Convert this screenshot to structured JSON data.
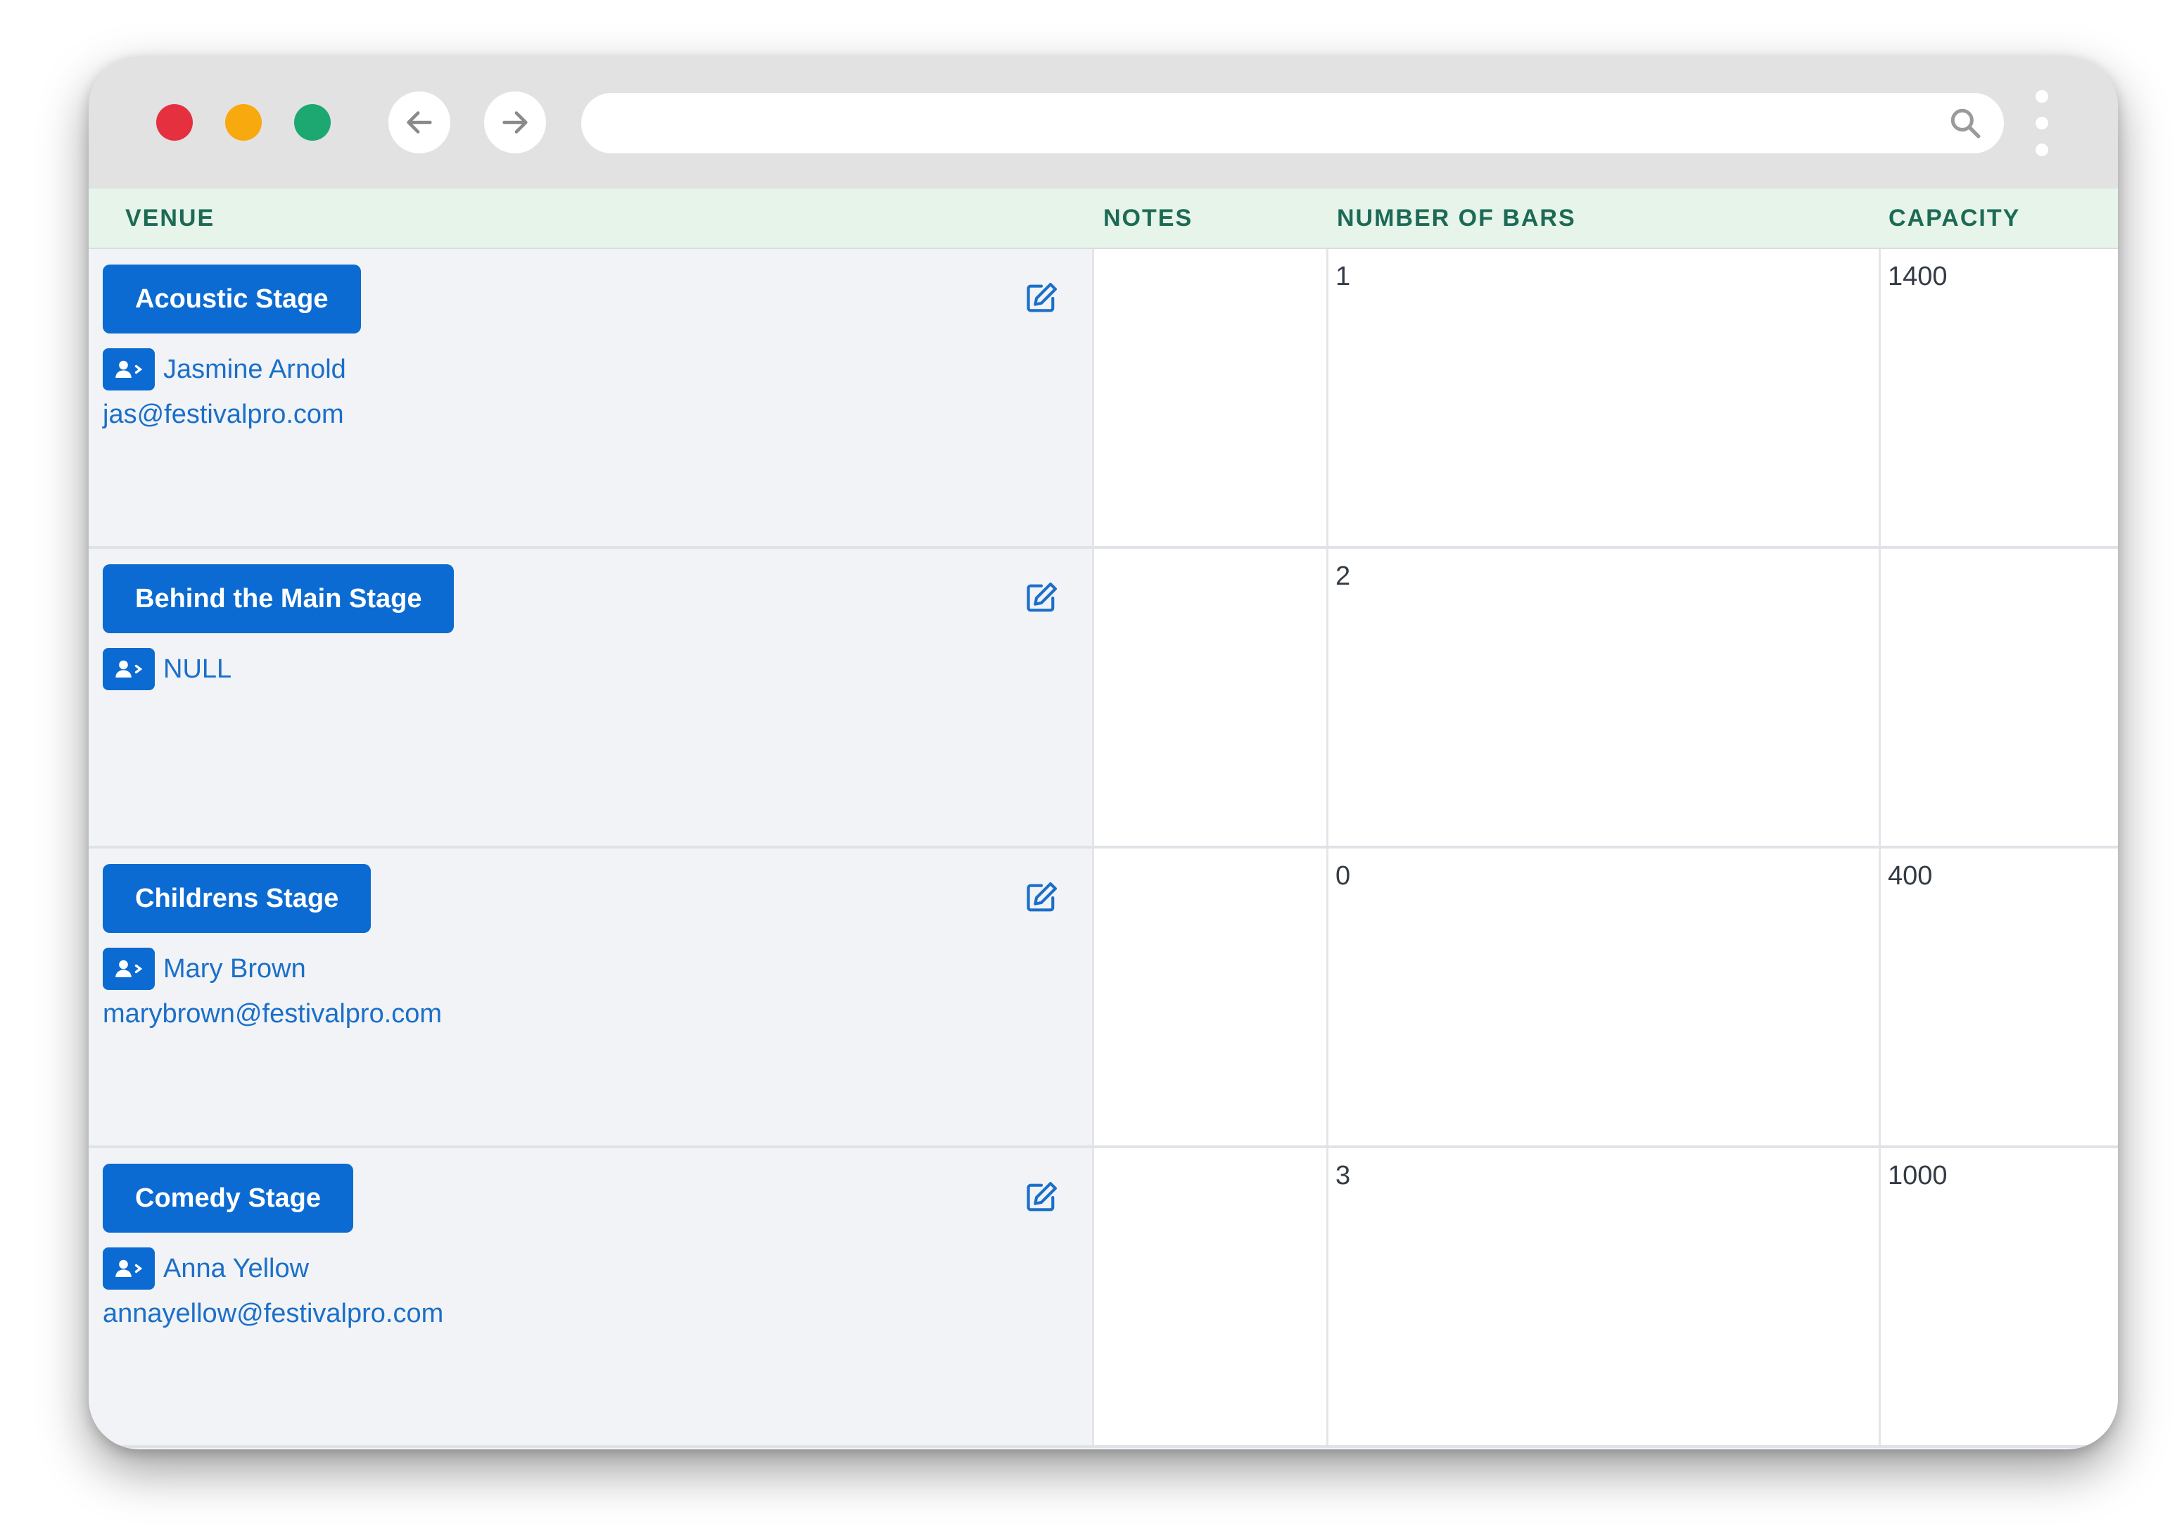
{
  "browser": {
    "colors": {
      "close": "#e5303f",
      "minimize": "#f7a90d",
      "maximize": "#1da871"
    },
    "icons": {
      "back": "arrow-left-icon",
      "forward": "arrow-right-icon",
      "search": "magnifier-icon",
      "menu": "kebab-icon"
    },
    "url": ""
  },
  "table": {
    "headers": {
      "venue": "VENUE",
      "notes": "NOTES",
      "bars": "NUMBER OF BARS",
      "capacity": "CAPACITY"
    },
    "rows": [
      {
        "venue": "Acoustic Stage",
        "contact": "Jasmine Arnold",
        "email": "jas@festivalpro.com",
        "notes": "",
        "bars": "1",
        "capacity": "1400"
      },
      {
        "venue": "Behind the Main Stage",
        "contact": "NULL",
        "email": "",
        "notes": "",
        "bars": "2",
        "capacity": ""
      },
      {
        "venue": "Childrens Stage",
        "contact": "Mary Brown",
        "email": "marybrown@festivalpro.com",
        "notes": "",
        "bars": "0",
        "capacity": "400"
      },
      {
        "venue": "Comedy Stage",
        "contact": "Anna Yellow",
        "email": "annayellow@festivalpro.com",
        "notes": "",
        "bars": "3",
        "capacity": "1000"
      }
    ]
  }
}
